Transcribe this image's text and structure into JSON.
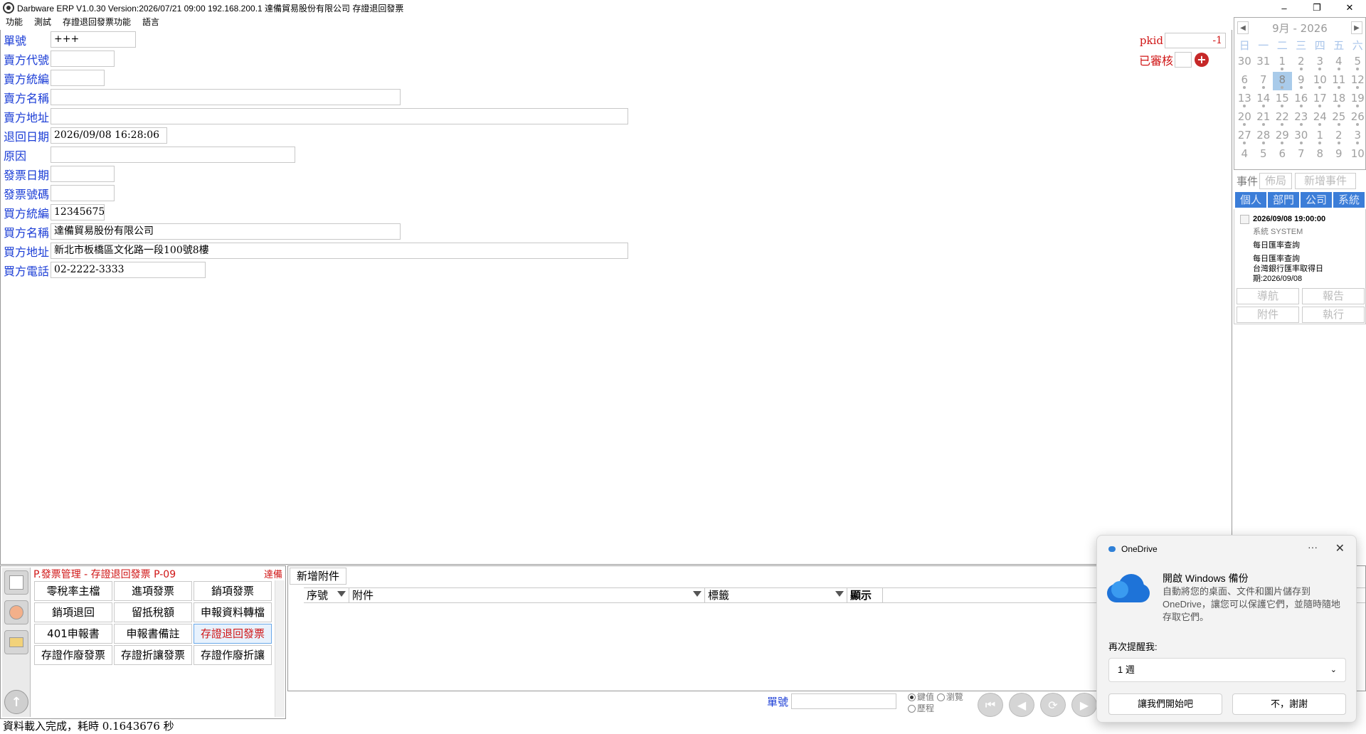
{
  "window": {
    "title": "Darbware ERP V1.0.30 Version:2026/07/21 09:00   192.168.200.1 達備貿易股份有限公司 存證退回發票",
    "minimize": "–",
    "restore": "❐",
    "close": "✕"
  },
  "menu": [
    "功能",
    "測試",
    "存證退回發票功能",
    "語言"
  ],
  "form": {
    "fields": [
      {
        "label": "單號",
        "value": "+++"
      },
      {
        "label": "賣方代號",
        "value": ""
      },
      {
        "label": "賣方統編",
        "value": ""
      },
      {
        "label": "賣方名稱",
        "value": ""
      },
      {
        "label": "賣方地址",
        "value": ""
      },
      {
        "label": "退回日期",
        "value": "2026/09/08 16:28:06"
      },
      {
        "label": "原因",
        "value": ""
      },
      {
        "label": "發票日期",
        "value": ""
      },
      {
        "label": "發票號碼",
        "value": ""
      },
      {
        "label": "買方統編",
        "value": "12345675"
      },
      {
        "label": "買方名稱",
        "value": "達備貿易股份有限公司"
      },
      {
        "label": "買方地址",
        "value": "新北市板橋區文化路一段100號8樓"
      },
      {
        "label": "買方電話",
        "value": "02-2222-3333"
      }
    ],
    "pkid_label": "pkid",
    "pkid_value": "-1",
    "audited_label": "已審核",
    "audit_add": "+"
  },
  "calendar": {
    "month": "9月",
    "sep": "-",
    "year": "2026",
    "prev": "◀",
    "next": "▶",
    "dow": [
      "日",
      "一",
      "二",
      "三",
      "四",
      "五",
      "六"
    ],
    "days": [
      "30",
      "31",
      "1",
      "2",
      "3",
      "4",
      "5",
      "6",
      "7",
      "8",
      "9",
      "10",
      "11",
      "12",
      "13",
      "14",
      "15",
      "16",
      "17",
      "18",
      "19",
      "20",
      "21",
      "22",
      "23",
      "24",
      "25",
      "26",
      "27",
      "28",
      "29",
      "30",
      "1",
      "2",
      "3",
      "4",
      "5",
      "6",
      "7",
      "8",
      "9",
      "10"
    ]
  },
  "events": {
    "label": "事件",
    "layout_btn": "佈局",
    "add_btn": "新增事件",
    "tabs": [
      "個人",
      "部門",
      "公司",
      "系統"
    ],
    "item": {
      "datetime": "2026/09/08 19:00:00",
      "source": "系統  SYSTEM",
      "title": "每日匯率查詢",
      "line1": "每日匯率查詢",
      "line2": "台灣銀行匯率取得日",
      "line3": "期:2026/09/08"
    },
    "btns": [
      "導航",
      "報告",
      "附件",
      "執行"
    ]
  },
  "module": {
    "title": "P.發票管理 - 存證退回發票  P-09",
    "corp": "達備",
    "buttons": [
      "零稅率主檔",
      "進項發票",
      "銷項發票",
      "銷項退回",
      "留抵稅額",
      "申報資料轉檔",
      "401申報書",
      "申報書備註",
      "存證退回發票",
      "存證作廢發票",
      "存證折讓發票",
      "存證作廢折讓"
    ],
    "active_index": 8
  },
  "attachments": {
    "add_btn": "新增附件",
    "columns": [
      "序號",
      "附件",
      "標籤",
      "顯示"
    ]
  },
  "nav": {
    "label": "單號",
    "radio1": "鍵值",
    "radio2": "瀏覽",
    "radio3": "歷程"
  },
  "status": "資料載入完成，耗時 0.1643676 秒",
  "toast": {
    "app": "OneDrive",
    "more": "···",
    "close": "✕",
    "title": "開啟 Windows 備份",
    "body": "自動將您的桌面、文件和圖片儲存到 OneDrive，讓您可以保護它們，並隨時隨地存取它們。",
    "remind_label": "再次提醒我:",
    "remind_value": "1 週",
    "chev": "⌄",
    "primary": "讓我們開始吧",
    "secondary": "不，謝謝"
  }
}
